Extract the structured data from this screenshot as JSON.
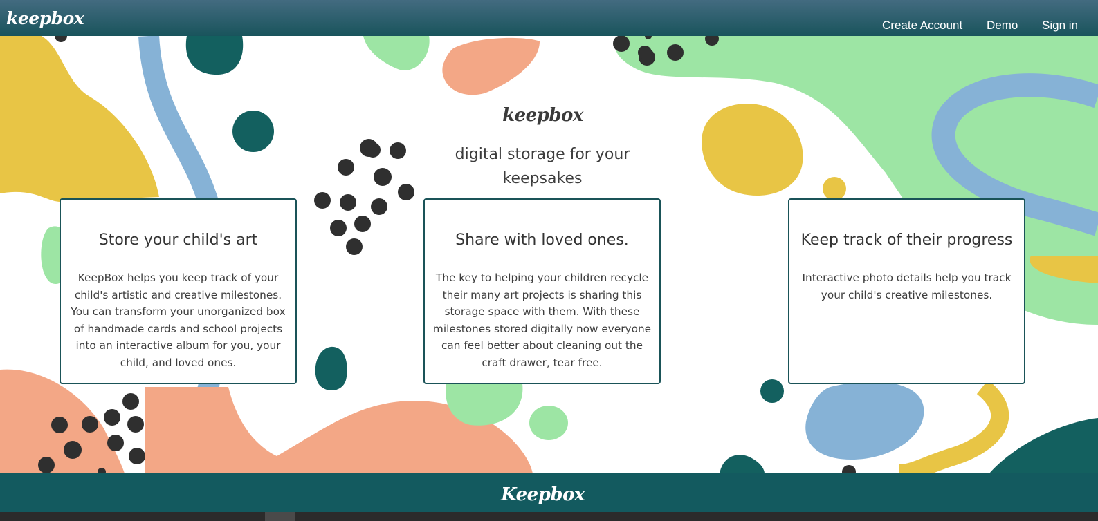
{
  "navbar": {
    "brand": "keepbox",
    "links": [
      "Create Account",
      "Demo",
      "Sign in"
    ]
  },
  "hero": {
    "logo": "keepbox",
    "tagline": "digital storage for your keepsakes"
  },
  "cards": [
    {
      "title": "Store your child's art",
      "body": "KeepBox helps you keep track of your child's artistic and creative milestones. You can transform your unorganized box of handmade cards and school projects into an interactive album for you, your child, and loved ones."
    },
    {
      "title": "Share with loved ones.",
      "body": "The key to helping your children recycle their many art projects is sharing this storage space with them. With these milestones stored digitally now everyone can feel better about cleaning out the craft drawer, tear free."
    },
    {
      "title": "Keep track of their progress",
      "body": "Interactive photo details help you track your child's creative milestones."
    }
  ],
  "footer": {
    "logo": "Keepbox"
  },
  "colors": {
    "navbar": "#1b545c",
    "teal": "#13605f",
    "yellow": "#e8c545",
    "blue": "#86b2d6",
    "green": "#9de5a4",
    "salmon": "#f3a786",
    "dots": "#2f2f2f"
  }
}
